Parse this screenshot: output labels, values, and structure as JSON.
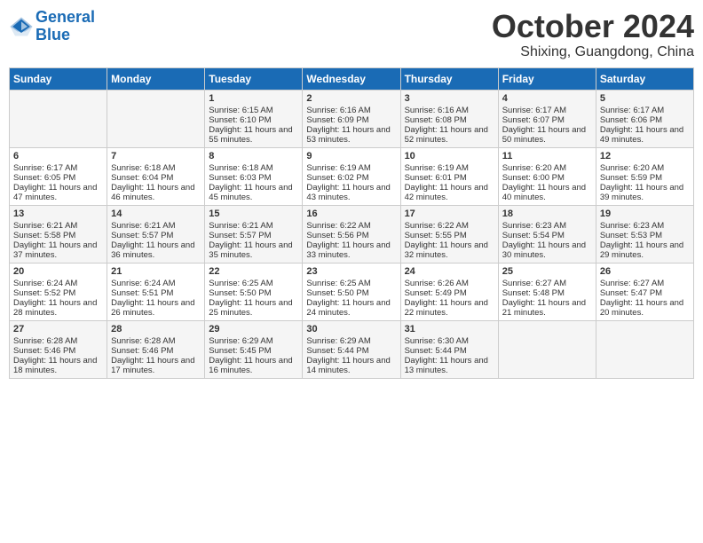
{
  "header": {
    "logo_line1": "General",
    "logo_line2": "Blue",
    "month": "October 2024",
    "location": "Shixing, Guangdong, China"
  },
  "weekdays": [
    "Sunday",
    "Monday",
    "Tuesday",
    "Wednesday",
    "Thursday",
    "Friday",
    "Saturday"
  ],
  "weeks": [
    [
      {
        "day": "",
        "sunrise": "",
        "sunset": "",
        "daylight": ""
      },
      {
        "day": "",
        "sunrise": "",
        "sunset": "",
        "daylight": ""
      },
      {
        "day": "1",
        "sunrise": "Sunrise: 6:15 AM",
        "sunset": "Sunset: 6:10 PM",
        "daylight": "Daylight: 11 hours and 55 minutes."
      },
      {
        "day": "2",
        "sunrise": "Sunrise: 6:16 AM",
        "sunset": "Sunset: 6:09 PM",
        "daylight": "Daylight: 11 hours and 53 minutes."
      },
      {
        "day": "3",
        "sunrise": "Sunrise: 6:16 AM",
        "sunset": "Sunset: 6:08 PM",
        "daylight": "Daylight: 11 hours and 52 minutes."
      },
      {
        "day": "4",
        "sunrise": "Sunrise: 6:17 AM",
        "sunset": "Sunset: 6:07 PM",
        "daylight": "Daylight: 11 hours and 50 minutes."
      },
      {
        "day": "5",
        "sunrise": "Sunrise: 6:17 AM",
        "sunset": "Sunset: 6:06 PM",
        "daylight": "Daylight: 11 hours and 49 minutes."
      }
    ],
    [
      {
        "day": "6",
        "sunrise": "Sunrise: 6:17 AM",
        "sunset": "Sunset: 6:05 PM",
        "daylight": "Daylight: 11 hours and 47 minutes."
      },
      {
        "day": "7",
        "sunrise": "Sunrise: 6:18 AM",
        "sunset": "Sunset: 6:04 PM",
        "daylight": "Daylight: 11 hours and 46 minutes."
      },
      {
        "day": "8",
        "sunrise": "Sunrise: 6:18 AM",
        "sunset": "Sunset: 6:03 PM",
        "daylight": "Daylight: 11 hours and 45 minutes."
      },
      {
        "day": "9",
        "sunrise": "Sunrise: 6:19 AM",
        "sunset": "Sunset: 6:02 PM",
        "daylight": "Daylight: 11 hours and 43 minutes."
      },
      {
        "day": "10",
        "sunrise": "Sunrise: 6:19 AM",
        "sunset": "Sunset: 6:01 PM",
        "daylight": "Daylight: 11 hours and 42 minutes."
      },
      {
        "day": "11",
        "sunrise": "Sunrise: 6:20 AM",
        "sunset": "Sunset: 6:00 PM",
        "daylight": "Daylight: 11 hours and 40 minutes."
      },
      {
        "day": "12",
        "sunrise": "Sunrise: 6:20 AM",
        "sunset": "Sunset: 5:59 PM",
        "daylight": "Daylight: 11 hours and 39 minutes."
      }
    ],
    [
      {
        "day": "13",
        "sunrise": "Sunrise: 6:21 AM",
        "sunset": "Sunset: 5:58 PM",
        "daylight": "Daylight: 11 hours and 37 minutes."
      },
      {
        "day": "14",
        "sunrise": "Sunrise: 6:21 AM",
        "sunset": "Sunset: 5:57 PM",
        "daylight": "Daylight: 11 hours and 36 minutes."
      },
      {
        "day": "15",
        "sunrise": "Sunrise: 6:21 AM",
        "sunset": "Sunset: 5:57 PM",
        "daylight": "Daylight: 11 hours and 35 minutes."
      },
      {
        "day": "16",
        "sunrise": "Sunrise: 6:22 AM",
        "sunset": "Sunset: 5:56 PM",
        "daylight": "Daylight: 11 hours and 33 minutes."
      },
      {
        "day": "17",
        "sunrise": "Sunrise: 6:22 AM",
        "sunset": "Sunset: 5:55 PM",
        "daylight": "Daylight: 11 hours and 32 minutes."
      },
      {
        "day": "18",
        "sunrise": "Sunrise: 6:23 AM",
        "sunset": "Sunset: 5:54 PM",
        "daylight": "Daylight: 11 hours and 30 minutes."
      },
      {
        "day": "19",
        "sunrise": "Sunrise: 6:23 AM",
        "sunset": "Sunset: 5:53 PM",
        "daylight": "Daylight: 11 hours and 29 minutes."
      }
    ],
    [
      {
        "day": "20",
        "sunrise": "Sunrise: 6:24 AM",
        "sunset": "Sunset: 5:52 PM",
        "daylight": "Daylight: 11 hours and 28 minutes."
      },
      {
        "day": "21",
        "sunrise": "Sunrise: 6:24 AM",
        "sunset": "Sunset: 5:51 PM",
        "daylight": "Daylight: 11 hours and 26 minutes."
      },
      {
        "day": "22",
        "sunrise": "Sunrise: 6:25 AM",
        "sunset": "Sunset: 5:50 PM",
        "daylight": "Daylight: 11 hours and 25 minutes."
      },
      {
        "day": "23",
        "sunrise": "Sunrise: 6:25 AM",
        "sunset": "Sunset: 5:50 PM",
        "daylight": "Daylight: 11 hours and 24 minutes."
      },
      {
        "day": "24",
        "sunrise": "Sunrise: 6:26 AM",
        "sunset": "Sunset: 5:49 PM",
        "daylight": "Daylight: 11 hours and 22 minutes."
      },
      {
        "day": "25",
        "sunrise": "Sunrise: 6:27 AM",
        "sunset": "Sunset: 5:48 PM",
        "daylight": "Daylight: 11 hours and 21 minutes."
      },
      {
        "day": "26",
        "sunrise": "Sunrise: 6:27 AM",
        "sunset": "Sunset: 5:47 PM",
        "daylight": "Daylight: 11 hours and 20 minutes."
      }
    ],
    [
      {
        "day": "27",
        "sunrise": "Sunrise: 6:28 AM",
        "sunset": "Sunset: 5:46 PM",
        "daylight": "Daylight: 11 hours and 18 minutes."
      },
      {
        "day": "28",
        "sunrise": "Sunrise: 6:28 AM",
        "sunset": "Sunset: 5:46 PM",
        "daylight": "Daylight: 11 hours and 17 minutes."
      },
      {
        "day": "29",
        "sunrise": "Sunrise: 6:29 AM",
        "sunset": "Sunset: 5:45 PM",
        "daylight": "Daylight: 11 hours and 16 minutes."
      },
      {
        "day": "30",
        "sunrise": "Sunrise: 6:29 AM",
        "sunset": "Sunset: 5:44 PM",
        "daylight": "Daylight: 11 hours and 14 minutes."
      },
      {
        "day": "31",
        "sunrise": "Sunrise: 6:30 AM",
        "sunset": "Sunset: 5:44 PM",
        "daylight": "Daylight: 11 hours and 13 minutes."
      },
      {
        "day": "",
        "sunrise": "",
        "sunset": "",
        "daylight": ""
      },
      {
        "day": "",
        "sunrise": "",
        "sunset": "",
        "daylight": ""
      }
    ]
  ]
}
